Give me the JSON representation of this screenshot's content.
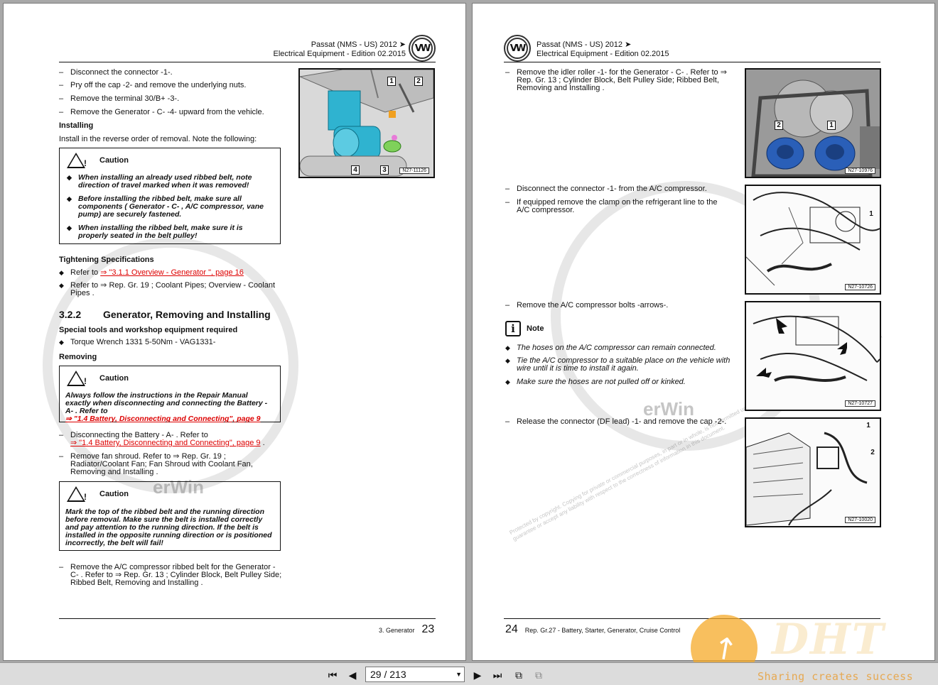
{
  "header": {
    "model": "Passat (NMS - US) 2012 ➤",
    "edition": "Electrical Equipment - Edition 02.2015",
    "logo": "VW"
  },
  "left": {
    "steps_top": [
      "Disconnect the connector -1-.",
      "Pry off the cap -2- and remove the underlying nuts.",
      "Remove the terminal 30/B+ -3-.",
      "Remove the Generator - C- -4- upward from the vehicle."
    ],
    "installing_heading": "Installing",
    "installing_text": "Install in the reverse order of removal. Note the following:",
    "caution1": {
      "label": "Caution",
      "items": [
        "When installing an already used ribbed belt, note direction of travel marked when it was removed!",
        "Before installing the ribbed belt, make sure all components ( Generator - C- , A/C compressor, vane pump) are securely fastened.",
        "When installing the ribbed belt, make sure it is properly seated in the belt pulley!"
      ]
    },
    "tightening_heading": "Tightening Specifications",
    "tight1_prefix": "Refer to ",
    "tight1_link": "⇒ \"3.1.1 Overview - Generator \", page 16",
    "tight2": "Refer to ⇒  Rep. Gr.  19 ; Coolant Pipes; Overview - Coolant Pipes .",
    "section_num": "3.2.2",
    "section_title": "Generator, Removing and Installing",
    "tools_heading": "Special tools and workshop equipment required",
    "tool1": "Torque Wrench 1331 5-50Nm - VAG1331-",
    "removing_heading": "Removing",
    "caution2": {
      "label": "Caution",
      "text": "Always follow the instructions in the Repair Manual exactly when disconnecting and connecting the Battery - A- . Refer to",
      "link": "⇒ \"1.4 Battery, Disconnecting and Connecting\", page 9"
    },
    "step_battery_text": "Disconnecting the Battery - A- . Refer to",
    "step_battery_link": "⇒ \"1.4 Battery, Disconnecting and Connecting\", page 9",
    "step_battery_end": " .",
    "step_fan": "Remove fan shroud. Refer to ⇒  Rep. Gr.  19 ; Radiator/Coolant Fan; Fan Shroud with Coolant Fan, Removing and Installing .",
    "caution3": {
      "label": "Caution",
      "text": "Mark the top of the ribbed belt and the running direction before removal. Make sure the belt is installed correctly and pay attention to the running direction. If the belt is installed in the opposite running direction or is positioned incorrectly, the belt will fail!"
    },
    "step_belt": "Remove the A/C compressor ribbed belt for the Generator - C- . Refer to ⇒  Rep. Gr.  13 ; Cylinder Block, Belt Pulley Side; Ribbed Belt, Removing and Installing .",
    "figure": {
      "code": "N27-11126",
      "callouts": [
        "1",
        "2",
        "3",
        "4"
      ]
    },
    "footer_section": "3. Generator",
    "footer_page": "23"
  },
  "right": {
    "step_idler": "Remove the idler roller -1- for the Generator - C- . Refer to ⇒ Rep. Gr.  13 ; Cylinder Block, Belt Pulley Side; Ribbed Belt, Removing and Installing .",
    "fig1": {
      "code": "N27-10976",
      "callouts": [
        "2",
        "1"
      ]
    },
    "step_connector": "Disconnect the connector -1- from the A/C compressor.",
    "step_clamp": "If equipped remove the clamp on the refrigerant line to the A/C compressor.",
    "fig2": {
      "code": "N27-10726",
      "callouts": [
        "1"
      ]
    },
    "step_bolts": "Remove the A/C compressor bolts -arrows-.",
    "note_label": "Note",
    "notes": [
      "The hoses on the A/C compressor can remain connected.",
      "Tie the A/C compressor to a suitable place on the vehicle with wire until it is time to install it again.",
      "Make sure the hoses are not pulled off or kinked."
    ],
    "fig3": {
      "code": "N27-10727"
    },
    "step_df": "Release the connector (DF lead) -1- and remove the cap -2-.",
    "fig4": {
      "code": "N27-10020",
      "callouts": [
        "1",
        "2"
      ]
    },
    "footer_page": "24",
    "footer_section": "Rep. Gr.27 - Battery, Starter, Generator, Cruise Control"
  },
  "watermark": {
    "arc_text": "Protected by copyright. Copying for private or commercial purposes, in part or in whole, is not permitted unless authorised by Volkswagen AG. Volkswagen AG does not guarantee or accept any liability with respect to the correctness of information in this document.",
    "brand": "erWin"
  },
  "toolbar": {
    "page_indicator": "29 / 213",
    "tagline": "Sharing creates success",
    "icons": [
      "first-page-icon",
      "prev-page-icon",
      "next-page-icon",
      "last-page-icon",
      "prev-view-icon",
      "next-view-icon"
    ]
  },
  "branding": {
    "big": "DHT"
  }
}
